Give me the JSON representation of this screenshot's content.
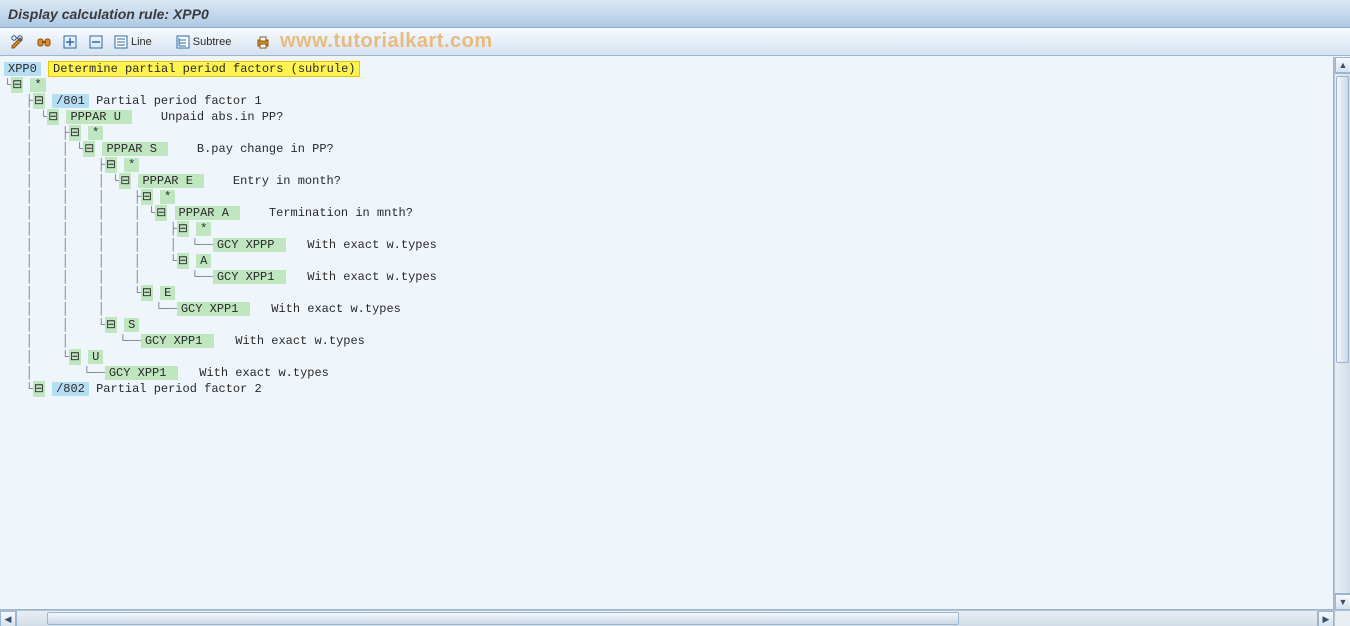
{
  "title": "Display calculation rule: XPP0",
  "watermark": "www.tutorialkart.com",
  "toolbar": {
    "line_label": "Line",
    "subtree_label": "Subtree"
  },
  "tree": {
    "root_code": "XPP0",
    "root_desc": "Determine partial period factors (subrule)",
    "glyph_expand": "⊟",
    "rows": [
      {
        "prefix": "",
        "e": false,
        "code": "XPP0",
        "code_cls": "chip-blue",
        "desc": "Determine partial period factors (subrule)",
        "desc_cls": "chip-yellow"
      },
      {
        "prefix": "└",
        "e": true,
        "code": "*",
        "code_cls": "chip-green",
        "desc": "",
        "desc_cls": ""
      },
      {
        "prefix": "   ├",
        "e": true,
        "code": "/801",
        "code_cls": "chip-blue",
        "desc": "Partial period factor 1",
        "desc_cls": ""
      },
      {
        "prefix": "   │ └",
        "e": true,
        "code": "PPPAR U ",
        "code_cls": "chip-green",
        "desc": "   Unpaid abs.in PP?",
        "desc_cls": ""
      },
      {
        "prefix": "   │    ├",
        "e": true,
        "code": "*",
        "code_cls": "chip-green",
        "desc": "",
        "desc_cls": ""
      },
      {
        "prefix": "   │    │ └",
        "e": true,
        "code": "PPPAR S ",
        "code_cls": "chip-green",
        "desc": "   B.pay change in PP?",
        "desc_cls": ""
      },
      {
        "prefix": "   │    │    ├",
        "e": true,
        "code": "*",
        "code_cls": "chip-green",
        "desc": "",
        "desc_cls": ""
      },
      {
        "prefix": "   │    │    │ └",
        "e": true,
        "code": "PPPAR E ",
        "code_cls": "chip-green",
        "desc": "   Entry in month?",
        "desc_cls": ""
      },
      {
        "prefix": "   │    │    │    ├",
        "e": true,
        "code": "*",
        "code_cls": "chip-green",
        "desc": "",
        "desc_cls": ""
      },
      {
        "prefix": "   │    │    │    │ └",
        "e": true,
        "code": "PPPAR A ",
        "code_cls": "chip-green",
        "desc": "   Termination in mnth?",
        "desc_cls": ""
      },
      {
        "prefix": "   │    │    │    │    ├",
        "e": true,
        "code": "*",
        "code_cls": "chip-green",
        "desc": "",
        "desc_cls": ""
      },
      {
        "prefix": "   │    │    │    │    │  └──",
        "e": false,
        "code": "GCY XPPP ",
        "code_cls": "chip-green",
        "desc": "  With exact w.types",
        "desc_cls": ""
      },
      {
        "prefix": "   │    │    │    │    └",
        "e": true,
        "code": "A",
        "code_cls": "chip-green",
        "desc": "",
        "desc_cls": ""
      },
      {
        "prefix": "   │    │    │    │       └──",
        "e": false,
        "code": "GCY XPP1 ",
        "code_cls": "chip-green",
        "desc": "  With exact w.types",
        "desc_cls": ""
      },
      {
        "prefix": "   │    │    │    └",
        "e": true,
        "code": "E",
        "code_cls": "chip-green",
        "desc": "",
        "desc_cls": ""
      },
      {
        "prefix": "   │    │    │       └──",
        "e": false,
        "code": "GCY XPP1 ",
        "code_cls": "chip-green",
        "desc": "  With exact w.types",
        "desc_cls": ""
      },
      {
        "prefix": "   │    │    └",
        "e": true,
        "code": "S",
        "code_cls": "chip-green",
        "desc": "",
        "desc_cls": ""
      },
      {
        "prefix": "   │    │       └──",
        "e": false,
        "code": "GCY XPP1 ",
        "code_cls": "chip-green",
        "desc": "  With exact w.types",
        "desc_cls": ""
      },
      {
        "prefix": "   │    └",
        "e": true,
        "code": "U",
        "code_cls": "chip-green",
        "desc": "",
        "desc_cls": ""
      },
      {
        "prefix": "   │       └──",
        "e": false,
        "code": "GCY XPP1 ",
        "code_cls": "chip-green",
        "desc": "  With exact w.types",
        "desc_cls": ""
      },
      {
        "prefix": "   └",
        "e": true,
        "code": "/802",
        "code_cls": "chip-blue",
        "desc": "Partial period factor 2",
        "desc_cls": ""
      }
    ]
  }
}
